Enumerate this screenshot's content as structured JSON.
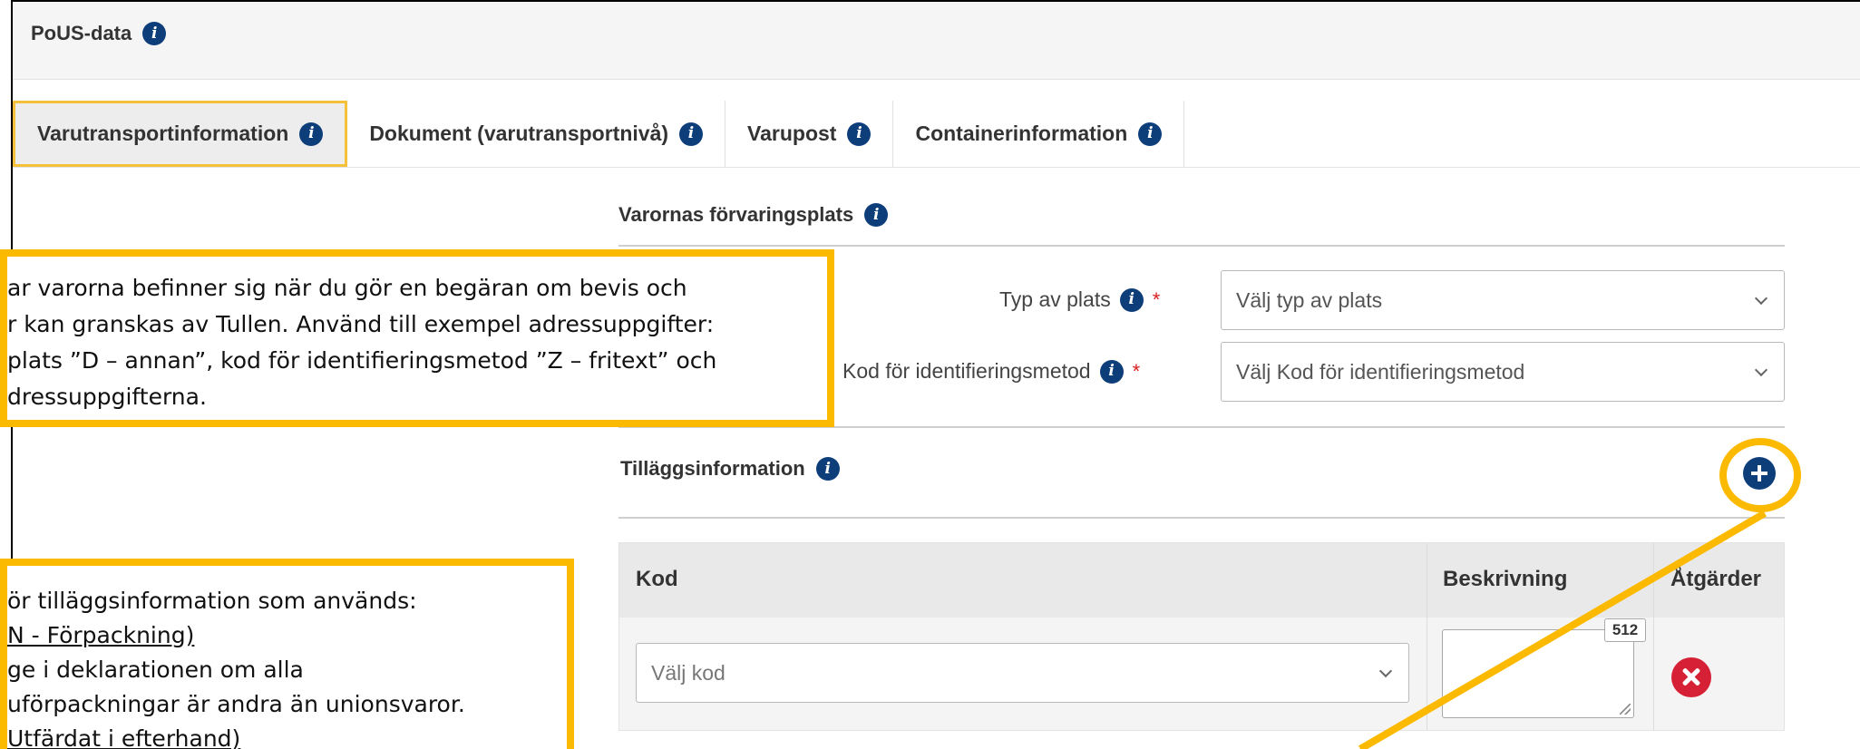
{
  "header": {
    "title": "PoUS-data"
  },
  "tabs": [
    {
      "label": "Varutransportinformation"
    },
    {
      "label": "Dokument (varutransportnivå)"
    },
    {
      "label": "Varupost"
    },
    {
      "label": "Containerinformation"
    }
  ],
  "storage_section": {
    "title": "Varornas förvaringsplats",
    "type_label": "Typ av plats",
    "type_placeholder": "Välj typ av plats",
    "method_label": "Kod för identifieringsmetod",
    "method_placeholder": "Välj Kod för identifieringsmetod",
    "required_mark": "*"
  },
  "additional_section": {
    "title": "Tilläggsinformation",
    "columns": [
      "Kod",
      "Beskrivning",
      "Åtgärder"
    ],
    "code_placeholder": "Välj kod",
    "char_counter": "512"
  },
  "callout_top": {
    "lines": [
      "ar varorna befinner sig när du gör en begäran om bevis och",
      "r kan granskas av Tullen. Använd till exempel adressuppgifter:",
      "plats ”D – annan”, kod för identifieringsmetod ”Z – fritext” och",
      "dressuppgifterna."
    ]
  },
  "callout_bottom": {
    "lines": [
      "ör tilläggsinformation som används:",
      "N - Förpackning)",
      "ge i deklarationen om alla",
      "uförpackningar är andra än unionsvaror.",
      "Utfärdat i efterhand)"
    ]
  },
  "colors": {
    "accent": "#fbb900",
    "info_icon": "#0e3e7a",
    "required": "#d81e1e",
    "delete": "#d62035"
  }
}
